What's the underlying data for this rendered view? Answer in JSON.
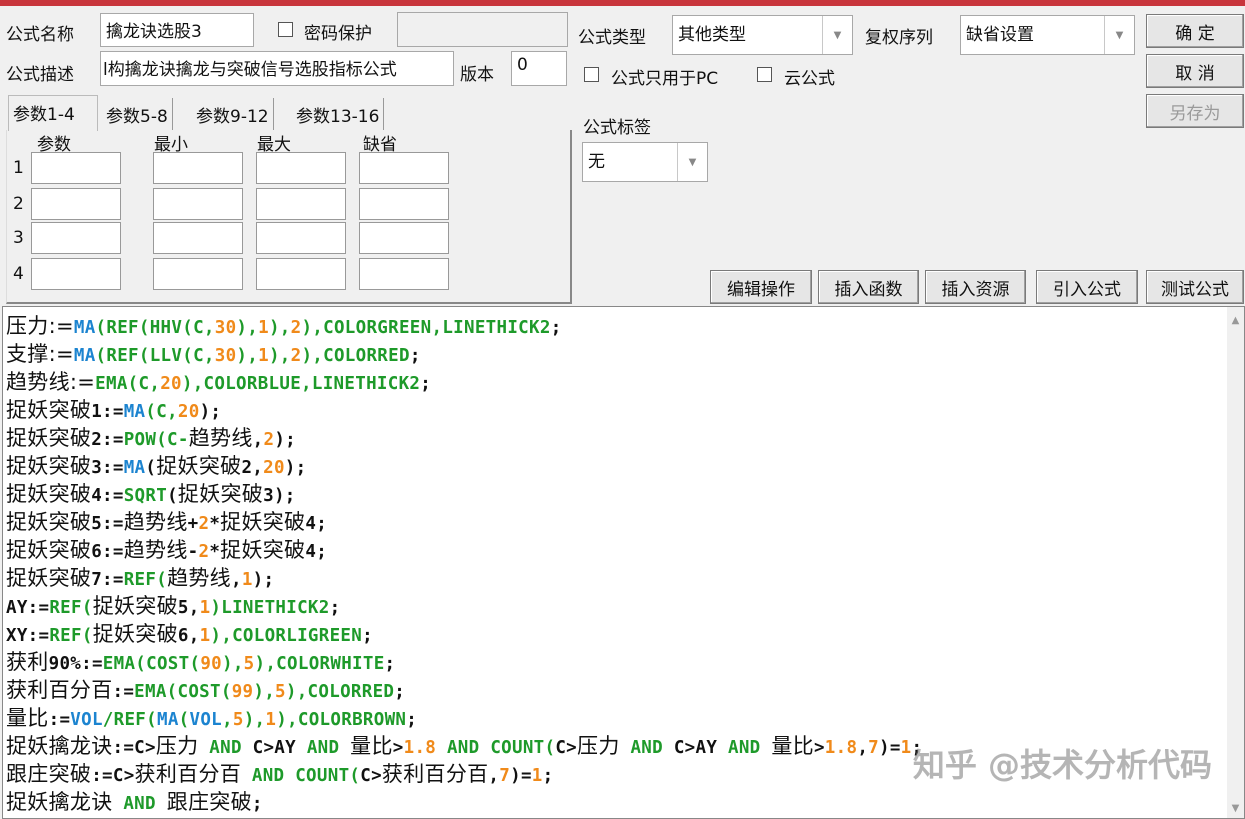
{
  "form": {
    "name_label": "公式名称",
    "name_value": "擒龙诀选股3",
    "password_label": "密码保护",
    "desc_label": "公式描述",
    "desc_value": "l构擒龙诀擒龙与突破信号选股指标公式",
    "version_label": "版本",
    "version_value": "0",
    "type_label": "公式类型",
    "type_value": "其他类型",
    "rights_label": "复权序列",
    "rights_value": "缺省设置",
    "pc_only_label": "公式只用于PC",
    "cloud_label": "云公式",
    "tag_label": "公式标签",
    "tag_value": "无"
  },
  "buttons": {
    "ok": "确  定",
    "cancel": "取  消",
    "save_as": "另存为"
  },
  "tabs": [
    "参数1-4",
    "参数5-8",
    "参数9-12",
    "参数13-16"
  ],
  "params": {
    "headers": [
      "参数",
      "最小",
      "最大",
      "缺省"
    ],
    "rows": [
      "1",
      "2",
      "3",
      "4"
    ]
  },
  "toolbar": [
    "编辑操作",
    "插入函数",
    "插入资源",
    "引入公式",
    "测试公式"
  ],
  "editor": {
    "lines": [
      [
        [
          "压力:=",
          "k"
        ],
        [
          "MA",
          "b"
        ],
        [
          "(REF(HHV(C,",
          "f"
        ],
        [
          "30",
          "n"
        ],
        [
          "),",
          "f"
        ],
        [
          "1",
          "n"
        ],
        [
          "),",
          "f"
        ],
        [
          "2",
          "n"
        ],
        [
          "),COLORGREEN,LINETHICK2",
          "f"
        ],
        [
          ";",
          "p"
        ]
      ],
      [
        [
          "支撑:=",
          "k"
        ],
        [
          "MA",
          "b"
        ],
        [
          "(REF(LLV(C,",
          "f"
        ],
        [
          "30",
          "n"
        ],
        [
          "),",
          "f"
        ],
        [
          "1",
          "n"
        ],
        [
          "),",
          "f"
        ],
        [
          "2",
          "n"
        ],
        [
          "),COLORRED",
          "f"
        ],
        [
          ";",
          "p"
        ]
      ],
      [
        [
          "趋势线:=",
          "k"
        ],
        [
          "EMA(C,",
          "f"
        ],
        [
          "20",
          "n"
        ],
        [
          "),COLORBLUE,LINETHICK2",
          "f"
        ],
        [
          ";",
          "p"
        ]
      ],
      [
        [
          "捉妖突破",
          "k"
        ],
        [
          "1:=",
          "p"
        ],
        [
          "MA",
          "b"
        ],
        [
          "(C,",
          "f"
        ],
        [
          "20",
          "n"
        ],
        [
          ");",
          "p"
        ]
      ],
      [
        [
          "捉妖突破",
          "k"
        ],
        [
          "2:=",
          "p"
        ],
        [
          "POW(C-",
          "f"
        ],
        [
          "趋势线",
          "k"
        ],
        [
          ",",
          "p"
        ],
        [
          "2",
          "n"
        ],
        [
          ");",
          "p"
        ]
      ],
      [
        [
          "捉妖突破",
          "k"
        ],
        [
          "3:=",
          "p"
        ],
        [
          "MA",
          "b"
        ],
        [
          "(",
          "p"
        ],
        [
          "捉妖突破",
          "k"
        ],
        [
          "2,",
          "p"
        ],
        [
          "20",
          "n"
        ],
        [
          ");",
          "p"
        ]
      ],
      [
        [
          "捉妖突破",
          "k"
        ],
        [
          "4:=",
          "p"
        ],
        [
          "SQRT",
          "f"
        ],
        [
          "(",
          "p"
        ],
        [
          "捉妖突破",
          "k"
        ],
        [
          "3);",
          "p"
        ]
      ],
      [
        [
          "捉妖突破",
          "k"
        ],
        [
          "5:=",
          "p"
        ],
        [
          "趋势线",
          "k"
        ],
        [
          "+",
          "p"
        ],
        [
          "2",
          "n"
        ],
        [
          "*",
          "p"
        ],
        [
          "捉妖突破",
          "k"
        ],
        [
          "4;",
          "p"
        ]
      ],
      [
        [
          "捉妖突破",
          "k"
        ],
        [
          "6:=",
          "p"
        ],
        [
          "趋势线",
          "k"
        ],
        [
          "-",
          "p"
        ],
        [
          "2",
          "n"
        ],
        [
          "*",
          "p"
        ],
        [
          "捉妖突破",
          "k"
        ],
        [
          "4;",
          "p"
        ]
      ],
      [
        [
          "捉妖突破",
          "k"
        ],
        [
          "7:=",
          "p"
        ],
        [
          "REF(",
          "f"
        ],
        [
          "趋势线",
          "k"
        ],
        [
          ",",
          "p"
        ],
        [
          "1",
          "n"
        ],
        [
          ");",
          "p"
        ]
      ],
      [
        [
          "AY:=",
          "p"
        ],
        [
          "REF(",
          "f"
        ],
        [
          "捉妖突破",
          "k"
        ],
        [
          "5,",
          "p"
        ],
        [
          "1",
          "n"
        ],
        [
          ")LINETHICK2",
          "f"
        ],
        [
          ";",
          "p"
        ]
      ],
      [
        [
          "XY:=",
          "p"
        ],
        [
          "REF(",
          "f"
        ],
        [
          "捉妖突破",
          "k"
        ],
        [
          "6,",
          "p"
        ],
        [
          "1",
          "n"
        ],
        [
          "),COLORLIGREEN",
          "f"
        ],
        [
          ";",
          "p"
        ]
      ],
      [
        [
          "获利",
          "k"
        ],
        [
          "90%:=",
          "p"
        ],
        [
          "EMA(COST(",
          "f"
        ],
        [
          "90",
          "n"
        ],
        [
          "),",
          "f"
        ],
        [
          "5",
          "n"
        ],
        [
          "),COLORWHITE",
          "f"
        ],
        [
          ";",
          "p"
        ]
      ],
      [
        [
          "获利百分百",
          "k"
        ],
        [
          ":=",
          "p"
        ],
        [
          "EMA(COST(",
          "f"
        ],
        [
          "99",
          "n"
        ],
        [
          "),",
          "f"
        ],
        [
          "5",
          "n"
        ],
        [
          "),COLORRED",
          "f"
        ],
        [
          ";",
          "p"
        ]
      ],
      [
        [
          "量比",
          "k"
        ],
        [
          ":=",
          "p"
        ],
        [
          "VOL",
          "b"
        ],
        [
          "/REF(",
          "f"
        ],
        [
          "MA",
          "b"
        ],
        [
          "(",
          "f"
        ],
        [
          "VOL",
          "b"
        ],
        [
          ",",
          "f"
        ],
        [
          "5",
          "n"
        ],
        [
          "),",
          "f"
        ],
        [
          "1",
          "n"
        ],
        [
          "),COLORBROWN",
          "f"
        ],
        [
          ";",
          "p"
        ]
      ],
      [
        [
          "捉妖擒龙诀",
          "k"
        ],
        [
          ":=C>",
          "p"
        ],
        [
          "压力",
          "k"
        ],
        [
          " AND ",
          "f"
        ],
        [
          "C>AY",
          "p"
        ],
        [
          " AND ",
          "f"
        ],
        [
          "量比",
          "k"
        ],
        [
          ">",
          "p"
        ],
        [
          "1.8",
          "n"
        ],
        [
          " AND COUNT(",
          "f"
        ],
        [
          "C>",
          "p"
        ],
        [
          "压力",
          "k"
        ],
        [
          " AND ",
          "f"
        ],
        [
          "C>AY",
          "p"
        ],
        [
          " AND ",
          "f"
        ],
        [
          "量比",
          "k"
        ],
        [
          ">",
          "p"
        ],
        [
          "1.8",
          "n"
        ],
        [
          ",",
          "p"
        ],
        [
          "7",
          "n"
        ],
        [
          ")=",
          "p"
        ],
        [
          "1",
          "n"
        ],
        [
          ";",
          "p"
        ]
      ],
      [
        [
          "跟庄突破",
          "k"
        ],
        [
          ":=C>",
          "p"
        ],
        [
          "获利百分百",
          "k"
        ],
        [
          " AND COUNT(",
          "f"
        ],
        [
          "C>",
          "p"
        ],
        [
          "获利百分百",
          "k"
        ],
        [
          ",",
          "p"
        ],
        [
          "7",
          "n"
        ],
        [
          ")=",
          "p"
        ],
        [
          "1",
          "n"
        ],
        [
          ";",
          "p"
        ]
      ],
      [
        [
          "捉妖擒龙诀",
          "k"
        ],
        [
          " AND ",
          "f"
        ],
        [
          "跟庄突破",
          "k"
        ],
        [
          ";",
          "p"
        ]
      ]
    ]
  },
  "watermark": "知乎 @技术分析代码",
  "colors": {
    "function": "#1e9a2a",
    "keyword_blue": "#1c84d0",
    "number": "#f08a1a",
    "title_bar": "#c8353c"
  }
}
